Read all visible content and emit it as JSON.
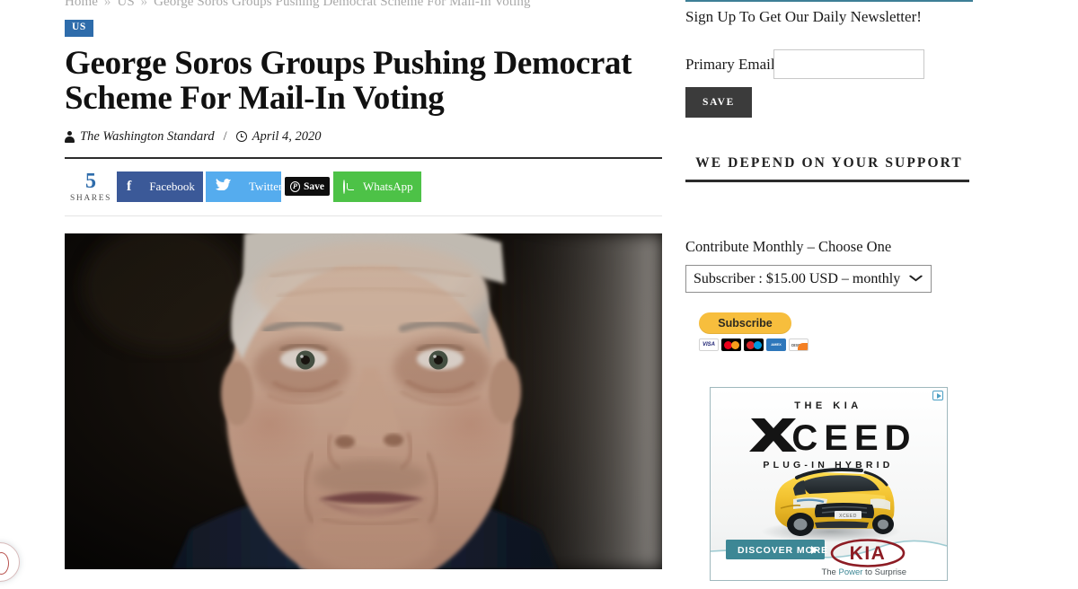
{
  "breadcrumb": {
    "items": [
      "Home",
      "US",
      "George Soros Groups Pushing Democrat Scheme For Mail-In Voting"
    ],
    "separator": "»"
  },
  "article": {
    "category_badge": "US",
    "headline": "George Soros Groups Pushing Democrat Scheme For Mail-In Voting",
    "author": "The Washington Standard",
    "byline_separator": "/",
    "date": "April 4, 2020",
    "hero_image_alt": "Close-up portrait of elderly man George Soros against dark background"
  },
  "share": {
    "count": "5",
    "count_label": "SHARES",
    "buttons": [
      {
        "name": "facebook",
        "label": "Facebook",
        "glyph": "f",
        "color": "#3b5998"
      },
      {
        "name": "twitter",
        "label": "Twitter",
        "glyph": "ᵛ",
        "color": "#55acee"
      },
      {
        "name": "pinterest",
        "label": "Save",
        "glyph": "P",
        "color": "#0e0e0e"
      },
      {
        "name": "whatsapp",
        "label": "WhatsApp",
        "glyph": "",
        "color": "#4dc247"
      }
    ]
  },
  "sidebar": {
    "newsletter": {
      "heading": "Sign Up To Get Our Daily Newsletter!",
      "email_label": "Primary Email",
      "email_value": "",
      "email_placeholder": "",
      "save_label": "SAVE"
    },
    "support": {
      "heading": "WE DEPEND ON YOUR SUPPORT"
    },
    "contribute": {
      "label": "Contribute Monthly – Choose One",
      "selected_option": "Subscriber : $15.00 USD – monthly",
      "options": [
        "Subscriber : $15.00 USD – monthly"
      ],
      "subscribe_label": "Subscribe",
      "chevron": "⌄",
      "cards": [
        "VISA",
        "Mastercard",
        "Maestro",
        "AMERICAN EXPRESS",
        "DISCOVER"
      ]
    }
  },
  "advertisement": {
    "brand_eyebrow": "THE  KIA",
    "model": "XCEED",
    "model_letters": [
      "X",
      "C",
      "E",
      "E",
      "D"
    ],
    "subtitle": "PLUG-IN  HYBRID",
    "cta_label": "DISCOVER MORE",
    "cta_arrow": "▶",
    "logo_text": "KIA",
    "tagline_pre": "The ",
    "tagline_accent": "Power",
    "tagline_post": " to Surprise",
    "adchoices_label": "AdChoices",
    "accent_color": "#3d8795",
    "car_color": "#f2c230",
    "logo_color": "#8d1c24"
  },
  "floating": {
    "widget_label": "feedback-widget"
  },
  "colors": {
    "link_blue": "#2e6cab",
    "teal_rule": "#3d7f96",
    "dark_rule": "#2b2b2b",
    "text": "#111111",
    "muted": "#a9a9a9"
  }
}
